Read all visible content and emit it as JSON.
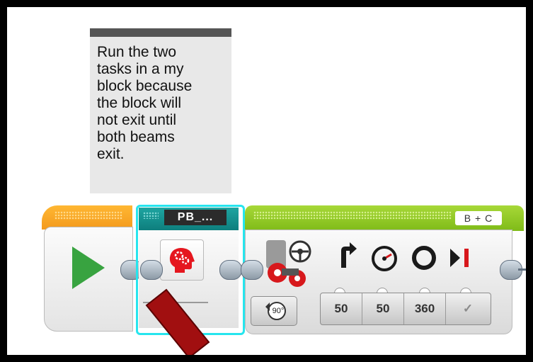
{
  "comment": {
    "text": "Run the two\ntasks in a my\nblock because\nthe block will\nnot exit until\nboth beams\nexit."
  },
  "start_block": {
    "icon": "play-icon",
    "accent_color": "#f39a1e"
  },
  "my_block": {
    "name": "PB_...",
    "icon": "brain-gears-icon",
    "accent_color": "#0e7e7d",
    "selection_color": "#26e5ee"
  },
  "move_steering": {
    "ports": "B + C",
    "accent_color": "#7fbb18",
    "mode_icon": "rotations-icon",
    "mode_label": "90°",
    "param_icons": [
      "steering-icon",
      "power-icon",
      "degrees-icon",
      "brake-icon"
    ],
    "params": [
      "50",
      "50",
      "360",
      "✓"
    ]
  },
  "annotation": {
    "arrow_color": "#a10f10"
  }
}
